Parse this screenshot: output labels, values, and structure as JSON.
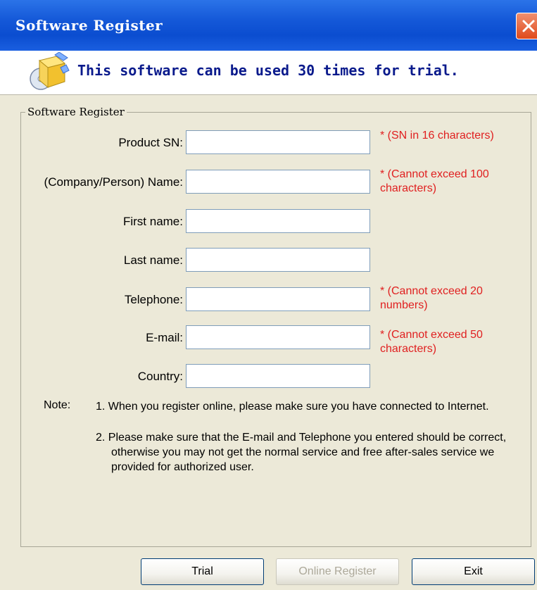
{
  "window": {
    "title": "Software Register",
    "trial_message": "This software can be used 30 times for trial."
  },
  "group": {
    "title": "Software Register"
  },
  "fields": [
    {
      "label": "Product SN:",
      "value": "",
      "hint": "* (SN in 16 characters)"
    },
    {
      "label": "(Company/Person) Name:",
      "value": "",
      "hint": "* (Cannot exceed 100 characters)"
    },
    {
      "label": "First name:",
      "value": "",
      "hint": ""
    },
    {
      "label": "Last name:",
      "value": "",
      "hint": ""
    },
    {
      "label": "Telephone:",
      "value": "",
      "hint": "* (Cannot exceed 20 numbers)"
    },
    {
      "label": "E-mail:",
      "value": "",
      "hint": "* (Cannot exceed 50 characters)"
    },
    {
      "label": "Country:",
      "value": "",
      "hint": ""
    }
  ],
  "note": {
    "label": "Note:",
    "items": [
      "1. When you register online, please make sure you have connected to Internet.",
      "2. Please make sure that the E-mail and Telephone you entered should be correct, otherwise you may not get the normal service and free after-sales service we provided for authorized user."
    ]
  },
  "buttons": {
    "trial": "Trial",
    "online_register": "Online Register",
    "exit": "Exit"
  },
  "colors": {
    "titlebar": "#0b4dd0",
    "hint": "#e02020",
    "header_text": "#0a1a8c",
    "dialog_bg": "#ece9d8"
  },
  "icons": {
    "header": "software-box-cd-icon",
    "close": "close-icon"
  }
}
